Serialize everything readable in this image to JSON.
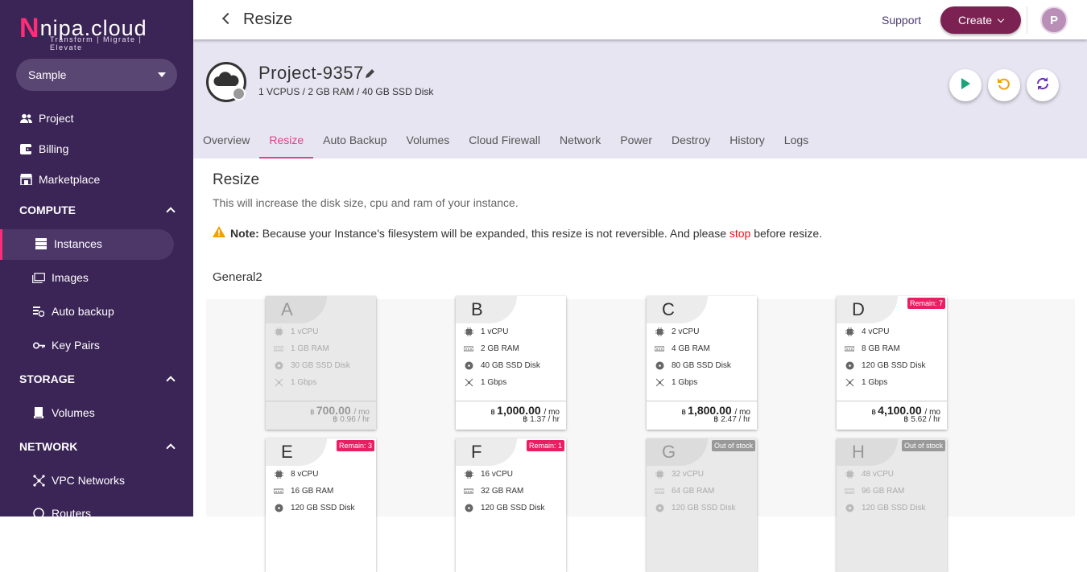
{
  "brand": {
    "name": "nipa.cloud",
    "tagline": "Transform | Migrate | Elevate"
  },
  "sidebar": {
    "project_select": "Sample",
    "items": [
      {
        "label": "Project",
        "icon": "users-icon"
      },
      {
        "label": "Billing",
        "icon": "wallet-icon"
      },
      {
        "label": "Marketplace",
        "icon": "store-icon"
      }
    ],
    "sections": [
      {
        "title": "COMPUTE",
        "items": [
          "Instances",
          "Images",
          "Auto backup",
          "Key Pairs"
        ]
      },
      {
        "title": "STORAGE",
        "items": [
          "Volumes"
        ]
      },
      {
        "title": "NETWORK",
        "items": [
          "VPC Networks",
          "Routers"
        ]
      }
    ],
    "active_item": "Instances"
  },
  "topbar": {
    "title": "Resize",
    "support": "Support",
    "create": "Create",
    "avatar": "P"
  },
  "instance": {
    "name": "Project-9357",
    "spec": "1 VCPUS / 2 GB RAM / 40 GB SSD Disk"
  },
  "tabs": [
    "Overview",
    "Resize",
    "Auto Backup",
    "Volumes",
    "Cloud Firewall",
    "Network",
    "Power",
    "Destroy",
    "History",
    "Logs"
  ],
  "active_tab": "Resize",
  "main": {
    "heading": "Resize",
    "description": "This will increase the disk size, cpu and ram of your instance.",
    "note_label": "Note:",
    "note_text": "Because your Instance's filesystem will be expanded, this resize is not reversible. And please",
    "note_stop": "stop",
    "note_end": "before resize.",
    "group": "General2"
  },
  "plans": [
    {
      "id": "A",
      "cpu": "1 vCPU",
      "ram": "1 GB RAM",
      "disk": "30 GB SSD Disk",
      "net": "1 Gbps",
      "currency": "฿",
      "price": "700.00",
      "per_mo": "/ mo",
      "hourly": "฿ 0.96 / hr",
      "badge": "",
      "disabled": true
    },
    {
      "id": "B",
      "cpu": "1 vCPU",
      "ram": "2 GB RAM",
      "disk": "40 GB SSD Disk",
      "net": "1 Gbps",
      "currency": "฿",
      "price": "1,000.00",
      "per_mo": "/ mo",
      "hourly": "฿ 1.37 / hr",
      "badge": "",
      "disabled": false
    },
    {
      "id": "C",
      "cpu": "2 vCPU",
      "ram": "4 GB RAM",
      "disk": "80 GB SSD Disk",
      "net": "1 Gbps",
      "currency": "฿",
      "price": "1,800.00",
      "per_mo": "/ mo",
      "hourly": "฿ 2.47 / hr",
      "badge": "",
      "disabled": false
    },
    {
      "id": "D",
      "cpu": "4 vCPU",
      "ram": "8 GB RAM",
      "disk": "120 GB SSD Disk",
      "net": "1 Gbps",
      "currency": "฿",
      "price": "4,100.00",
      "per_mo": "/ mo",
      "hourly": "฿ 5.62 / hr",
      "badge": "Remain: 7",
      "disabled": false
    },
    {
      "id": "E",
      "cpu": "8 vCPU",
      "ram": "16 GB RAM",
      "disk": "120 GB SSD Disk",
      "badge": "Remain: 3",
      "disabled": false
    },
    {
      "id": "F",
      "cpu": "16 vCPU",
      "ram": "32 GB RAM",
      "disk": "120 GB SSD Disk",
      "badge": "Remain: 1",
      "disabled": false
    },
    {
      "id": "G",
      "cpu": "32 vCPU",
      "ram": "64 GB RAM",
      "disk": "120 GB SSD Disk",
      "badge": "Out of stock",
      "disabled": true
    },
    {
      "id": "H",
      "cpu": "48 vCPU",
      "ram": "96 GB RAM",
      "disk": "120 GB SSD Disk",
      "badge": "Out of stock",
      "disabled": true
    }
  ],
  "colors": {
    "sidebar": "#3b2456",
    "accent": "#e0408a",
    "create": "#7b2252",
    "header_bg": "#e7e5f1"
  }
}
